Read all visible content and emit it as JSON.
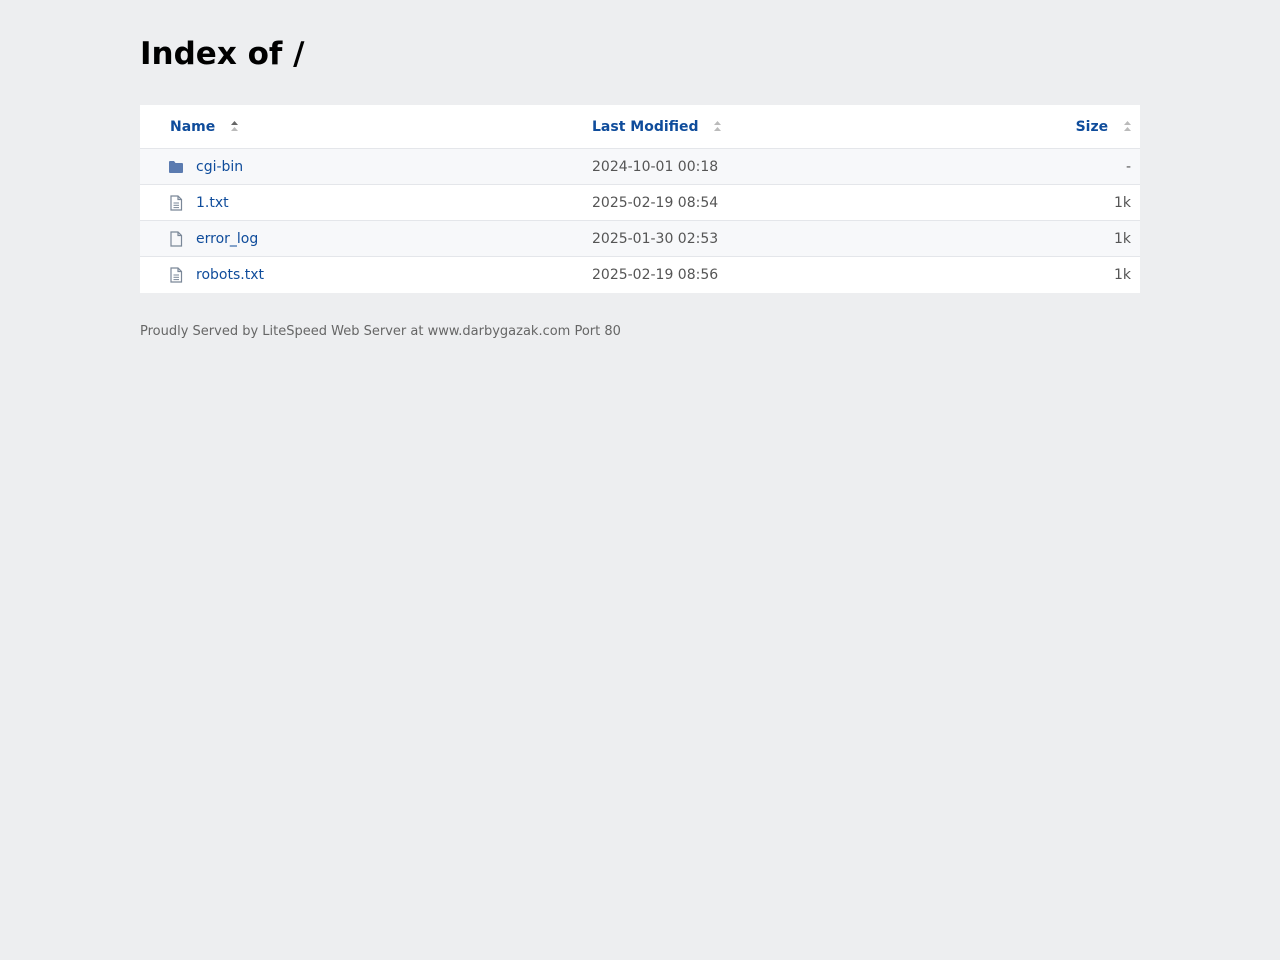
{
  "page": {
    "title": "Index of /"
  },
  "table": {
    "headers": {
      "name": "Name",
      "last_modified": "Last Modified",
      "size": "Size"
    },
    "rows": [
      {
        "icon": "folder-icon",
        "name": "cgi-bin",
        "modified": "2024-10-01 00:18",
        "size": "-"
      },
      {
        "icon": "text-file-icon",
        "name": "1.txt",
        "modified": "2025-02-19 08:54",
        "size": "1k"
      },
      {
        "icon": "file-icon",
        "name": "error_log",
        "modified": "2025-01-30 02:53",
        "size": "1k"
      },
      {
        "icon": "text-file-icon",
        "name": "robots.txt",
        "modified": "2025-02-19 08:56",
        "size": "1k"
      }
    ]
  },
  "footer": {
    "text": "Proudly Served by LiteSpeed Web Server at www.darbygazak.com Port 80"
  },
  "colors": {
    "link": "#0f4c9b",
    "folder": "#5b7bb0",
    "background": "#edeef0"
  }
}
